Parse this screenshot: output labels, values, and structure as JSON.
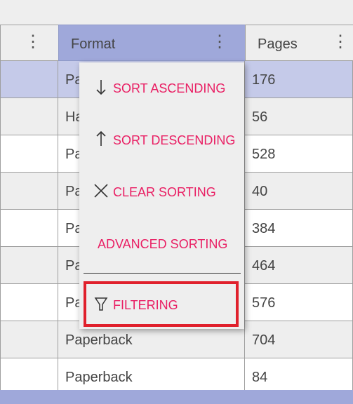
{
  "colors": {
    "accent": "#e91e63",
    "header_selected": "#9fa8da",
    "row_selected": "#c5cae9",
    "highlight_box": "#e0202c"
  },
  "header": {
    "columns": [
      {
        "label": "",
        "selected": false
      },
      {
        "label": "Format",
        "selected": true
      },
      {
        "label": "Pages",
        "selected": false
      }
    ],
    "menu_icon": "more-vert-icon"
  },
  "rows": [
    {
      "c0": "",
      "format": "Pa",
      "pages": "176",
      "selected": true
    },
    {
      "c0": "",
      "format": "Ha",
      "pages": "56",
      "selected": false
    },
    {
      "c0": "",
      "format": "Pa",
      "pages": "528",
      "selected": false
    },
    {
      "c0": "",
      "format": "Pa",
      "pages": "40",
      "selected": false
    },
    {
      "c0": "",
      "format": "Pa",
      "pages": "384",
      "selected": false
    },
    {
      "c0": "",
      "format": "Pa",
      "pages": "464",
      "selected": false
    },
    {
      "c0": "",
      "format": "Pa",
      "pages": "576",
      "selected": false
    },
    {
      "c0": "",
      "format": "Paperback",
      "pages": "704",
      "selected": false
    },
    {
      "c0": "",
      "format": "Paperback",
      "pages": "84",
      "selected": false
    }
  ],
  "menu": {
    "items": [
      {
        "label": "SORT ASCENDING",
        "icon": "arrow-down-icon"
      },
      {
        "label": "SORT DESCENDING",
        "icon": "arrow-up-icon"
      },
      {
        "label": "CLEAR SORTING",
        "icon": "close-icon"
      },
      {
        "label": "ADVANCED SORTING",
        "icon": ""
      },
      {
        "label": "FILTERING",
        "icon": "filter-icon"
      }
    ]
  }
}
